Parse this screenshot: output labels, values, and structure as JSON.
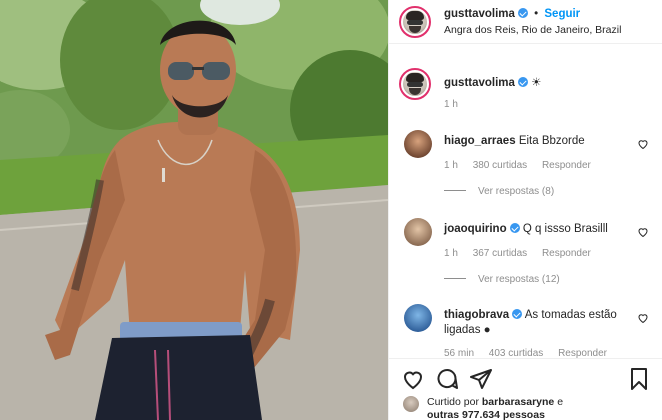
{
  "header": {
    "username": "gusttavolima",
    "separator": "•",
    "follow_label": "Seguir",
    "location": "Angra dos Reis, Rio de Janeiro, Brazil"
  },
  "caption": {
    "username": "gusttavolima",
    "text": "☀",
    "time": "1 h"
  },
  "comments": [
    {
      "username": "hiago_arraes",
      "verified": false,
      "text": "Eita Bbzorde",
      "time": "1 h",
      "likes": "380 curtidas",
      "reply_label": "Responder",
      "view_replies": "Ver respostas (8)"
    },
    {
      "username": "joaoquirino",
      "verified": true,
      "text": "Q q issso Brasilll",
      "time": "1 h",
      "likes": "367 curtidas",
      "reply_label": "Responder",
      "view_replies": "Ver respostas (12)"
    },
    {
      "username": "thiagobrava",
      "verified": true,
      "text": "As tomadas estão ligadas",
      "emoji": "●",
      "time": "56 min",
      "likes": "403 curtidas",
      "reply_label": "Responder"
    }
  ],
  "likes": {
    "prefix": "Curtido por",
    "user": "barbarasaryne",
    "suffix": "e",
    "others": "outras 977.634 pessoas"
  },
  "icons": [
    "heart-icon",
    "comment-icon",
    "share-icon",
    "bookmark-icon"
  ],
  "colors": {
    "accent": "#0095f6",
    "verified": "#3897f0",
    "muted": "#8e8e8e",
    "text": "#262626",
    "story_ring": "#e1306c"
  }
}
